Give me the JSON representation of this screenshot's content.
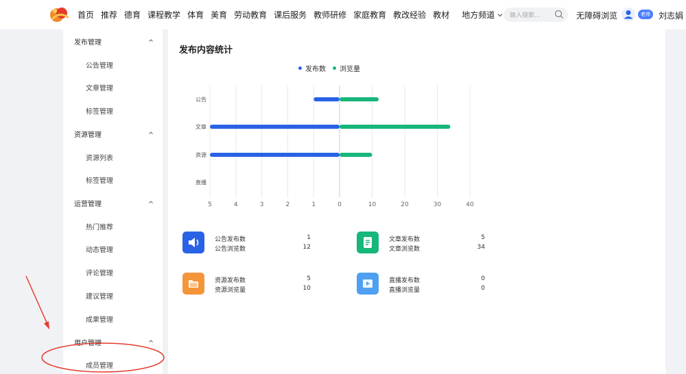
{
  "header": {
    "nav_items": [
      "首页",
      "推荐",
      "德育",
      "课程教学",
      "体育",
      "美育",
      "劳动教育",
      "课后服务",
      "教师研修",
      "家庭教育",
      "教改经验",
      "教材"
    ],
    "local_channel": "地方频道",
    "search_placeholder": "输入搜索...",
    "accessibility": "无障碍浏览",
    "role_badge": "老师",
    "user_name": "刘志娟"
  },
  "sidebar": {
    "groups": [
      {
        "label": "发布管理",
        "items": [
          "公告管理",
          "文章管理",
          "标签管理"
        ]
      },
      {
        "label": "资源管理",
        "items": [
          "资源列表",
          "标签管理"
        ]
      },
      {
        "label": "运营管理",
        "items": [
          "热门推荐",
          "动态管理",
          "评论管理",
          "建议管理",
          "成果管理"
        ]
      },
      {
        "label": "用户管理",
        "items": [
          "成员管理"
        ]
      }
    ]
  },
  "main": {
    "title": "发布内容统计",
    "stats": [
      {
        "pub_label": "公告发布数",
        "pub_value": "1",
        "view_label": "公告浏览数",
        "view_value": "12",
        "icon": "speaker-icon",
        "color": "#2a62e6"
      },
      {
        "pub_label": "文章发布数",
        "pub_value": "5",
        "view_label": "文章浏览数",
        "view_value": "34",
        "icon": "document-icon",
        "color": "#17b67a"
      },
      {
        "pub_label": "资源发布数",
        "pub_value": "5",
        "view_label": "资源浏览量",
        "view_value": "10",
        "icon": "folder-icon",
        "color": "#f4953a"
      },
      {
        "pub_label": "直播发布数",
        "pub_value": "0",
        "view_label": "直播浏览量",
        "view_value": "0",
        "icon": "video-icon",
        "color": "#4f9ff2"
      }
    ]
  },
  "chart_data": {
    "type": "bar",
    "orientation": "horizontal-diverging",
    "categories": [
      "公告",
      "文章",
      "资源",
      "直播"
    ],
    "series": [
      {
        "name": "发布数",
        "values": [
          1,
          5,
          5,
          0
        ],
        "color": "#2a62e6",
        "direction": "left"
      },
      {
        "name": "浏览量",
        "values": [
          12,
          34,
          10,
          0
        ],
        "color": "#17b67a",
        "direction": "right"
      }
    ],
    "x_ticks_left": [
      "5",
      "4",
      "3",
      "2",
      "1"
    ],
    "x_ticks_right": [
      "0",
      "10",
      "20",
      "30",
      "40"
    ],
    "xlim_left": [
      0,
      5
    ],
    "xlim_right": [
      0,
      40
    ],
    "grid": true,
    "legend": "top-center"
  },
  "colors": {
    "accent": "#2a62e6",
    "green": "#17b67a",
    "annotation": "#e53b2c"
  }
}
